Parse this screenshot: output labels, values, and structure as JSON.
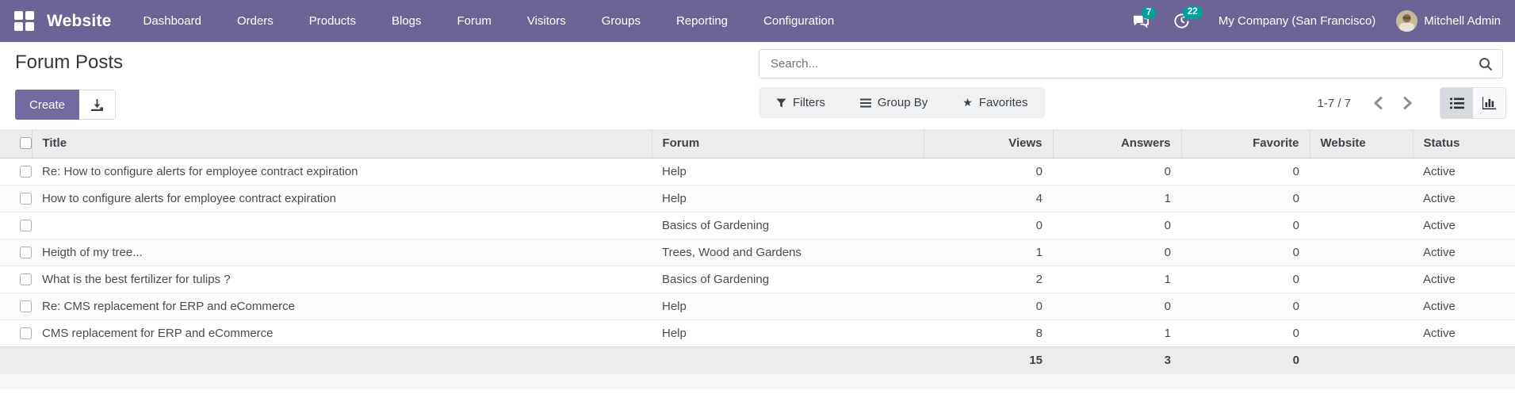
{
  "colors": {
    "navbar_bg": "#6d6496",
    "accent_purple": "#7569a1",
    "badge_teal": "#00a09d"
  },
  "navbar": {
    "brand": "Website",
    "items": [
      "Dashboard",
      "Orders",
      "Products",
      "Blogs",
      "Forum",
      "Visitors",
      "Groups",
      "Reporting",
      "Configuration"
    ],
    "messages_count": "7",
    "activities_count": "22",
    "company": "My Company (San Francisco)",
    "user_name": "Mitchell Admin",
    "icons": [
      "apps-grid-icon",
      "messages-icon",
      "activities-clock-icon",
      "avatar"
    ]
  },
  "control_panel": {
    "title": "Forum Posts",
    "create_label": "Create",
    "export_icon": "download-icon",
    "search_placeholder": "Search...",
    "filters_label": "Filters",
    "group_by_label": "Group By",
    "favorites_label": "Favorites",
    "pager_text": "1-7 / 7",
    "view_switcher": [
      "list-view",
      "graph-view"
    ],
    "active_view": "list-view"
  },
  "table": {
    "headers": {
      "title": "Title",
      "forum": "Forum",
      "views": "Views",
      "answers": "Answers",
      "favorite": "Favorite",
      "website": "Website",
      "status": "Status"
    },
    "rows": [
      {
        "title": "Re: How to configure alerts for employee contract expiration",
        "forum": "Help",
        "views": "0",
        "answers": "0",
        "favorite": "0",
        "website": "",
        "status": "Active"
      },
      {
        "title": "How to configure alerts for employee contract expiration",
        "forum": "Help",
        "views": "4",
        "answers": "1",
        "favorite": "0",
        "website": "",
        "status": "Active"
      },
      {
        "title": "",
        "forum": "Basics of Gardening",
        "views": "0",
        "answers": "0",
        "favorite": "0",
        "website": "",
        "status": "Active"
      },
      {
        "title": "Heigth of my tree...",
        "forum": "Trees, Wood and Gardens",
        "views": "1",
        "answers": "0",
        "favorite": "0",
        "website": "",
        "status": "Active"
      },
      {
        "title": "What is the best fertilizer for tulips ?",
        "forum": "Basics of Gardening",
        "views": "2",
        "answers": "1",
        "favorite": "0",
        "website": "",
        "status": "Active"
      },
      {
        "title": "Re: CMS replacement for ERP and eCommerce",
        "forum": "Help",
        "views": "0",
        "answers": "0",
        "favorite": "0",
        "website": "",
        "status": "Active"
      },
      {
        "title": "CMS replacement for ERP and eCommerce",
        "forum": "Help",
        "views": "8",
        "answers": "1",
        "favorite": "0",
        "website": "",
        "status": "Active"
      }
    ],
    "totals": {
      "views": "15",
      "answers": "3",
      "favorite": "0"
    }
  }
}
